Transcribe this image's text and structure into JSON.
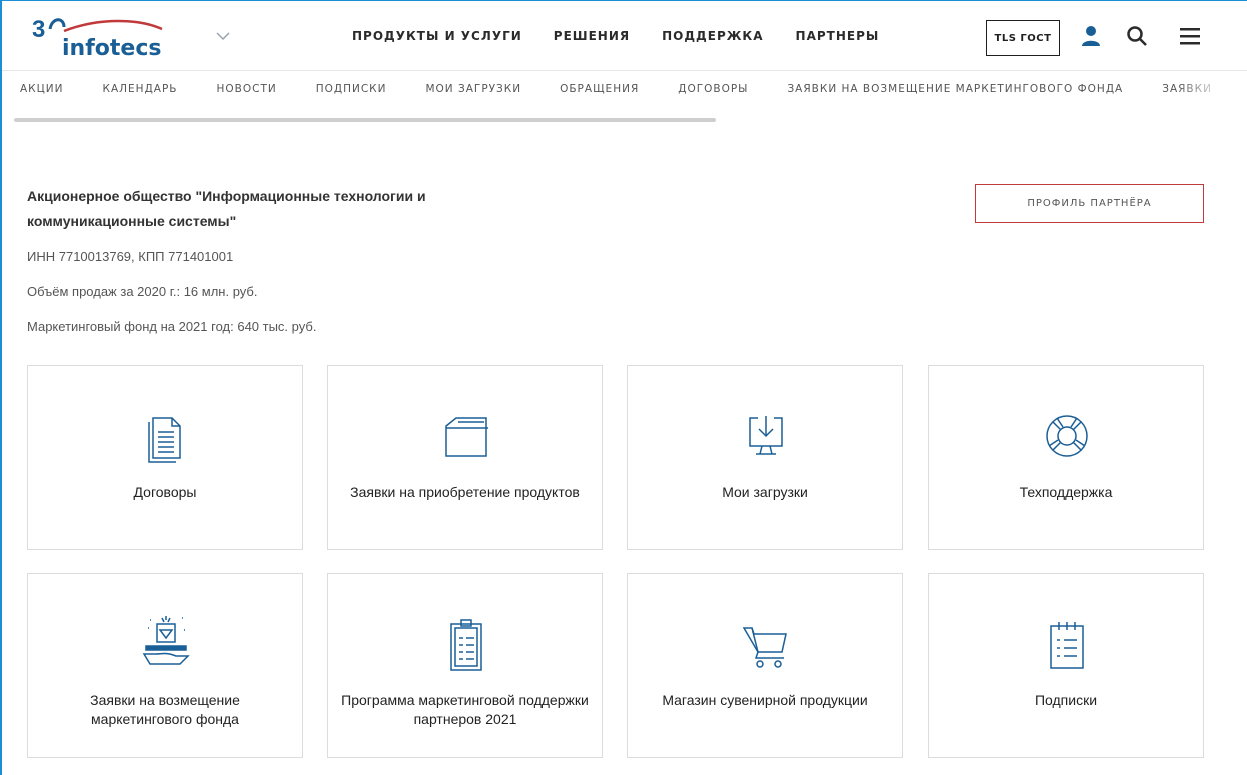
{
  "header": {
    "logo": {
      "prefix": "3",
      "wordmark": "infotecs"
    },
    "nav": [
      "ПРОДУКТЫ И УСЛУГИ",
      "РЕШЕНИЯ",
      "ПОДДЕРЖКА",
      "ПАРТНЕРЫ"
    ],
    "tls_label": "TLS ГОСТ",
    "icons": [
      "user-icon",
      "search-icon",
      "menu-icon"
    ]
  },
  "subnav": [
    "АКЦИИ",
    "КАЛЕНДАРЬ",
    "НОВОСТИ",
    "ПОДПИСКИ",
    "МОИ ЗАГРУЗКИ",
    "ОБРАЩЕНИЯ",
    "ДОГОВОРЫ",
    "ЗАЯВКИ НА ВОЗМЕЩЕНИЕ МАРКЕТИНГОВОГО ФОНДА",
    "ЗАЯВКИ"
  ],
  "company": {
    "name": "Акционерное общество \"Информационные технологии и коммуникационные системы\"",
    "inn": "ИНН 7710013769, КПП 771401001",
    "sales": "Объём продаж за 2020 г.: 16 млн. руб.",
    "fund": "Маркетинговый фонд на 2021 год: 640 тыс. руб."
  },
  "profile_button": "ПРОФИЛЬ ПАРТНЁРА",
  "tiles": [
    {
      "label": "Договоры",
      "icon": "document-icon"
    },
    {
      "label": "Заявки на приобретение продуктов",
      "icon": "folder-icon"
    },
    {
      "label": "Мои загрузки",
      "icon": "download-monitor-icon"
    },
    {
      "label": "Техподдержка",
      "icon": "lifebuoy-icon"
    },
    {
      "label": "Заявки на возмещение маркетингового фонда",
      "icon": "diamond-hand-icon"
    },
    {
      "label": "Программа маркетинговой поддержки партнеров 2021",
      "icon": "clipboard-icon"
    },
    {
      "label": "Магазин сувенирной продукции",
      "icon": "cart-icon"
    },
    {
      "label": "Подписки",
      "icon": "notepad-icon"
    }
  ],
  "colors": {
    "accent_blue": "#1a5e96",
    "logo_red": "#c0393b",
    "frame_blue": "#1a8fd6"
  }
}
